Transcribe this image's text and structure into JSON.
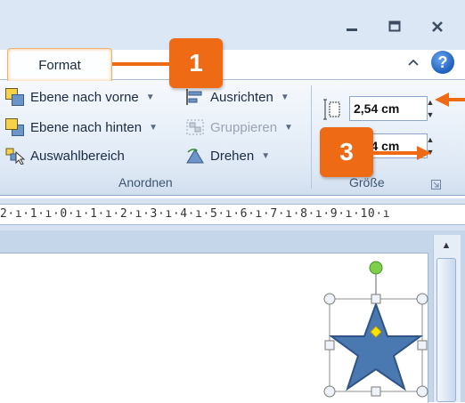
{
  "window": {
    "minimize_icon": "minimize-icon",
    "restore_icon": "restore-icon",
    "close_icon": "close-icon",
    "help_label": "?",
    "collapse_icon": "chevron-up-icon"
  },
  "tabs": {
    "format_label": "Format"
  },
  "ribbon": {
    "arrange": {
      "bring_forward": "Ebene nach vorne",
      "send_backward": "Ebene nach hinten",
      "selection_pane": "Auswahlbereich",
      "align": "Ausrichten",
      "group": "Gruppieren",
      "rotate": "Drehen",
      "group_label": "Anordnen"
    },
    "size": {
      "height_value": "2,54  cm",
      "width_value": "2,54  cm",
      "group_label": "Größe"
    }
  },
  "ruler": {
    "text": "2·ı·1·ı·0·ı·1·ı·2·ı·3·ı·4·ı·5·ı·6·ı·7·ı·8·ı·9·ı·10·ı"
  },
  "callouts": [
    {
      "label": "1"
    },
    {
      "label": "3"
    }
  ],
  "colors": {
    "accent_orange": "#ee6a14",
    "star_fill": "#4a78b0",
    "rotation_handle": "#7ed04b",
    "adjust_handle": "#ffe600"
  }
}
